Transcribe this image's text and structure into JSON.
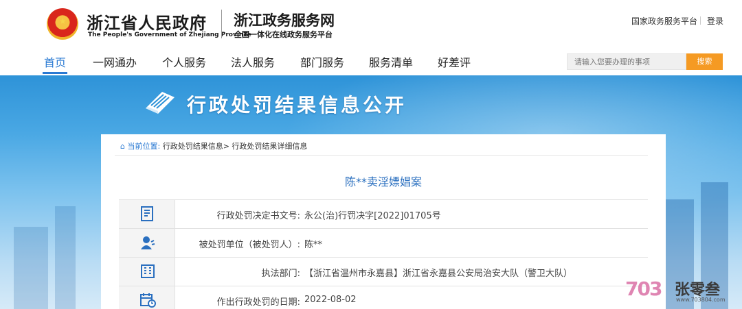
{
  "header": {
    "gov_name_cn": "浙江省人民政府",
    "gov_name_en": "The People's Government of Zhejiang Province",
    "portal_name": "浙江政务服务网",
    "portal_sub": "全国一体化在线政务服务平台",
    "national_platform_link": "国家政务服务平台",
    "login_link": "登录"
  },
  "nav": {
    "items": [
      "首页",
      "一网通办",
      "个人服务",
      "法人服务",
      "部门服务",
      "服务清单",
      "好差评"
    ],
    "active_index": 0
  },
  "search": {
    "placeholder": "请输入您要办理的事项",
    "button": "搜索"
  },
  "banner": {
    "title": "行政处罚结果信息公开"
  },
  "breadcrumb": {
    "prefix": "当前位置:",
    "item1": "行政处罚结果信息",
    "sep": ">",
    "item2": "行政处罚结果详细信息"
  },
  "case": {
    "title": "陈**卖淫嫖娼案",
    "rows": [
      {
        "icon": "document-icon",
        "label": "行政处罚决定书文号:",
        "value": "永公(治)行罚决字[2022]01705号"
      },
      {
        "icon": "person-icon",
        "label": "被处罚单位（被处罚人）:",
        "value": "陈**"
      },
      {
        "icon": "building-icon",
        "label": "执法部门:",
        "value": "【浙江省温州市永嘉县】浙江省永嘉县公安局治安大队（警卫大队）"
      },
      {
        "icon": "calendar-icon",
        "label": "作出行政处罚的日期:",
        "value": "2022-08-02"
      }
    ]
  },
  "watermark": {
    "logo": "703",
    "name": "张零叁",
    "url": "www.703804.com"
  },
  "colors": {
    "accent_blue": "#2a7ad3",
    "search_orange": "#f59a23",
    "title_blue": "#2a6fbf"
  }
}
